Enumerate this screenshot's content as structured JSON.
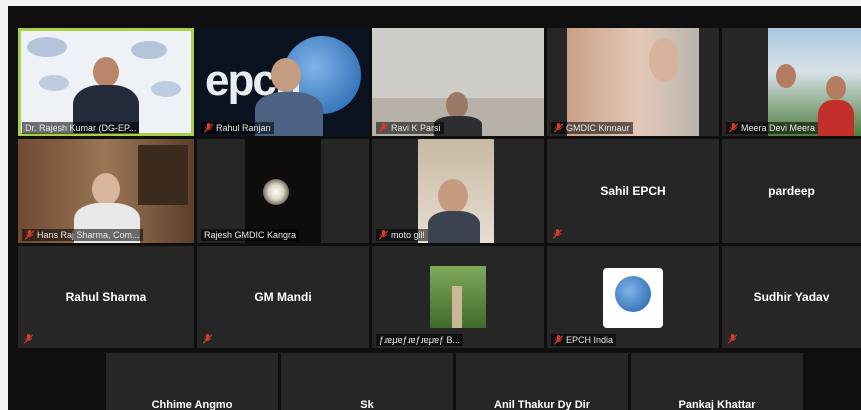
{
  "meeting": {
    "participants_row1": [
      {
        "label": "Dr. Rajesh Kumar (DG-EP..."
      },
      {
        "label": "Rahul Ranjan"
      },
      {
        "label": "Ravi K Parsi"
      },
      {
        "label": "GMDIC Kinnaur"
      },
      {
        "label": "Meera Devi Meera"
      }
    ],
    "participants_row2": [
      {
        "label": "Hans Raj Sharma, Com..."
      },
      {
        "label": "Rajesh GMDIC Kangra"
      },
      {
        "label": "moto gill"
      },
      {
        "name": "Sahil EPCH"
      },
      {
        "name": "pardeep"
      }
    ],
    "participants_row3": [
      {
        "name": "Rahul Sharma"
      },
      {
        "name": "GM Mandi"
      },
      {
        "label": "ƒɹɐɟɹɐƒɹɐƒɹɐɟɹɐƒ B..."
      },
      {
        "label": "EPCH India"
      },
      {
        "name": "Sudhir Yadav"
      }
    ],
    "participants_row4": [
      {
        "name": "Chhime Angmo"
      },
      {
        "name": "Sk"
      },
      {
        "name": "Anil Thakur Dy Dir"
      },
      {
        "name": "Pankaj Khattar"
      }
    ],
    "logo_text": "epch",
    "colors": {
      "mute_red": "#d83a2f",
      "active_speaker": "#a8d04b",
      "tile_bg": "#262626"
    }
  }
}
